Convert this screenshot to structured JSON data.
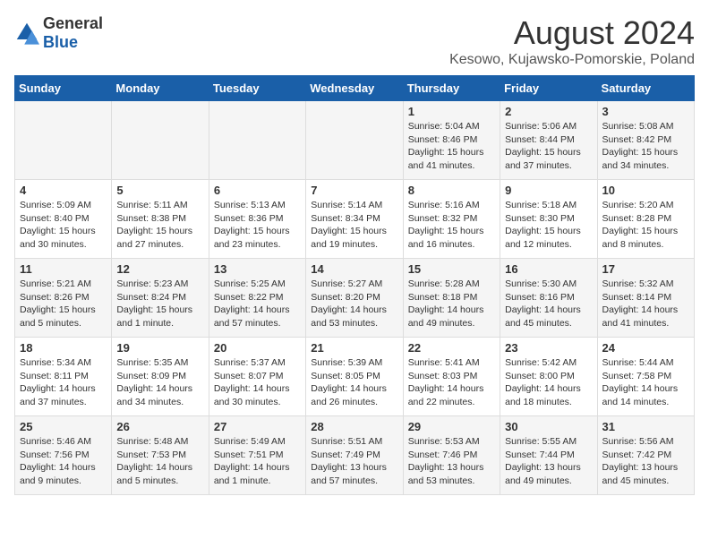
{
  "logo": {
    "general": "General",
    "blue": "Blue"
  },
  "title": "August 2024",
  "location": "Kesowo, Kujawsko-Pomorskie, Poland",
  "weekdays": [
    "Sunday",
    "Monday",
    "Tuesday",
    "Wednesday",
    "Thursday",
    "Friday",
    "Saturday"
  ],
  "weeks": [
    [
      {
        "day": "",
        "info": ""
      },
      {
        "day": "",
        "info": ""
      },
      {
        "day": "",
        "info": ""
      },
      {
        "day": "",
        "info": ""
      },
      {
        "day": "1",
        "info": "Sunrise: 5:04 AM\nSunset: 8:46 PM\nDaylight: 15 hours\nand 41 minutes."
      },
      {
        "day": "2",
        "info": "Sunrise: 5:06 AM\nSunset: 8:44 PM\nDaylight: 15 hours\nand 37 minutes."
      },
      {
        "day": "3",
        "info": "Sunrise: 5:08 AM\nSunset: 8:42 PM\nDaylight: 15 hours\nand 34 minutes."
      }
    ],
    [
      {
        "day": "4",
        "info": "Sunrise: 5:09 AM\nSunset: 8:40 PM\nDaylight: 15 hours\nand 30 minutes."
      },
      {
        "day": "5",
        "info": "Sunrise: 5:11 AM\nSunset: 8:38 PM\nDaylight: 15 hours\nand 27 minutes."
      },
      {
        "day": "6",
        "info": "Sunrise: 5:13 AM\nSunset: 8:36 PM\nDaylight: 15 hours\nand 23 minutes."
      },
      {
        "day": "7",
        "info": "Sunrise: 5:14 AM\nSunset: 8:34 PM\nDaylight: 15 hours\nand 19 minutes."
      },
      {
        "day": "8",
        "info": "Sunrise: 5:16 AM\nSunset: 8:32 PM\nDaylight: 15 hours\nand 16 minutes."
      },
      {
        "day": "9",
        "info": "Sunrise: 5:18 AM\nSunset: 8:30 PM\nDaylight: 15 hours\nand 12 minutes."
      },
      {
        "day": "10",
        "info": "Sunrise: 5:20 AM\nSunset: 8:28 PM\nDaylight: 15 hours\nand 8 minutes."
      }
    ],
    [
      {
        "day": "11",
        "info": "Sunrise: 5:21 AM\nSunset: 8:26 PM\nDaylight: 15 hours\nand 5 minutes."
      },
      {
        "day": "12",
        "info": "Sunrise: 5:23 AM\nSunset: 8:24 PM\nDaylight: 15 hours\nand 1 minute."
      },
      {
        "day": "13",
        "info": "Sunrise: 5:25 AM\nSunset: 8:22 PM\nDaylight: 14 hours\nand 57 minutes."
      },
      {
        "day": "14",
        "info": "Sunrise: 5:27 AM\nSunset: 8:20 PM\nDaylight: 14 hours\nand 53 minutes."
      },
      {
        "day": "15",
        "info": "Sunrise: 5:28 AM\nSunset: 8:18 PM\nDaylight: 14 hours\nand 49 minutes."
      },
      {
        "day": "16",
        "info": "Sunrise: 5:30 AM\nSunset: 8:16 PM\nDaylight: 14 hours\nand 45 minutes."
      },
      {
        "day": "17",
        "info": "Sunrise: 5:32 AM\nSunset: 8:14 PM\nDaylight: 14 hours\nand 41 minutes."
      }
    ],
    [
      {
        "day": "18",
        "info": "Sunrise: 5:34 AM\nSunset: 8:11 PM\nDaylight: 14 hours\nand 37 minutes."
      },
      {
        "day": "19",
        "info": "Sunrise: 5:35 AM\nSunset: 8:09 PM\nDaylight: 14 hours\nand 34 minutes."
      },
      {
        "day": "20",
        "info": "Sunrise: 5:37 AM\nSunset: 8:07 PM\nDaylight: 14 hours\nand 30 minutes."
      },
      {
        "day": "21",
        "info": "Sunrise: 5:39 AM\nSunset: 8:05 PM\nDaylight: 14 hours\nand 26 minutes."
      },
      {
        "day": "22",
        "info": "Sunrise: 5:41 AM\nSunset: 8:03 PM\nDaylight: 14 hours\nand 22 minutes."
      },
      {
        "day": "23",
        "info": "Sunrise: 5:42 AM\nSunset: 8:00 PM\nDaylight: 14 hours\nand 18 minutes."
      },
      {
        "day": "24",
        "info": "Sunrise: 5:44 AM\nSunset: 7:58 PM\nDaylight: 14 hours\nand 14 minutes."
      }
    ],
    [
      {
        "day": "25",
        "info": "Sunrise: 5:46 AM\nSunset: 7:56 PM\nDaylight: 14 hours\nand 9 minutes."
      },
      {
        "day": "26",
        "info": "Sunrise: 5:48 AM\nSunset: 7:53 PM\nDaylight: 14 hours\nand 5 minutes."
      },
      {
        "day": "27",
        "info": "Sunrise: 5:49 AM\nSunset: 7:51 PM\nDaylight: 14 hours\nand 1 minute."
      },
      {
        "day": "28",
        "info": "Sunrise: 5:51 AM\nSunset: 7:49 PM\nDaylight: 13 hours\nand 57 minutes."
      },
      {
        "day": "29",
        "info": "Sunrise: 5:53 AM\nSunset: 7:46 PM\nDaylight: 13 hours\nand 53 minutes."
      },
      {
        "day": "30",
        "info": "Sunrise: 5:55 AM\nSunset: 7:44 PM\nDaylight: 13 hours\nand 49 minutes."
      },
      {
        "day": "31",
        "info": "Sunrise: 5:56 AM\nSunset: 7:42 PM\nDaylight: 13 hours\nand 45 minutes."
      }
    ]
  ]
}
